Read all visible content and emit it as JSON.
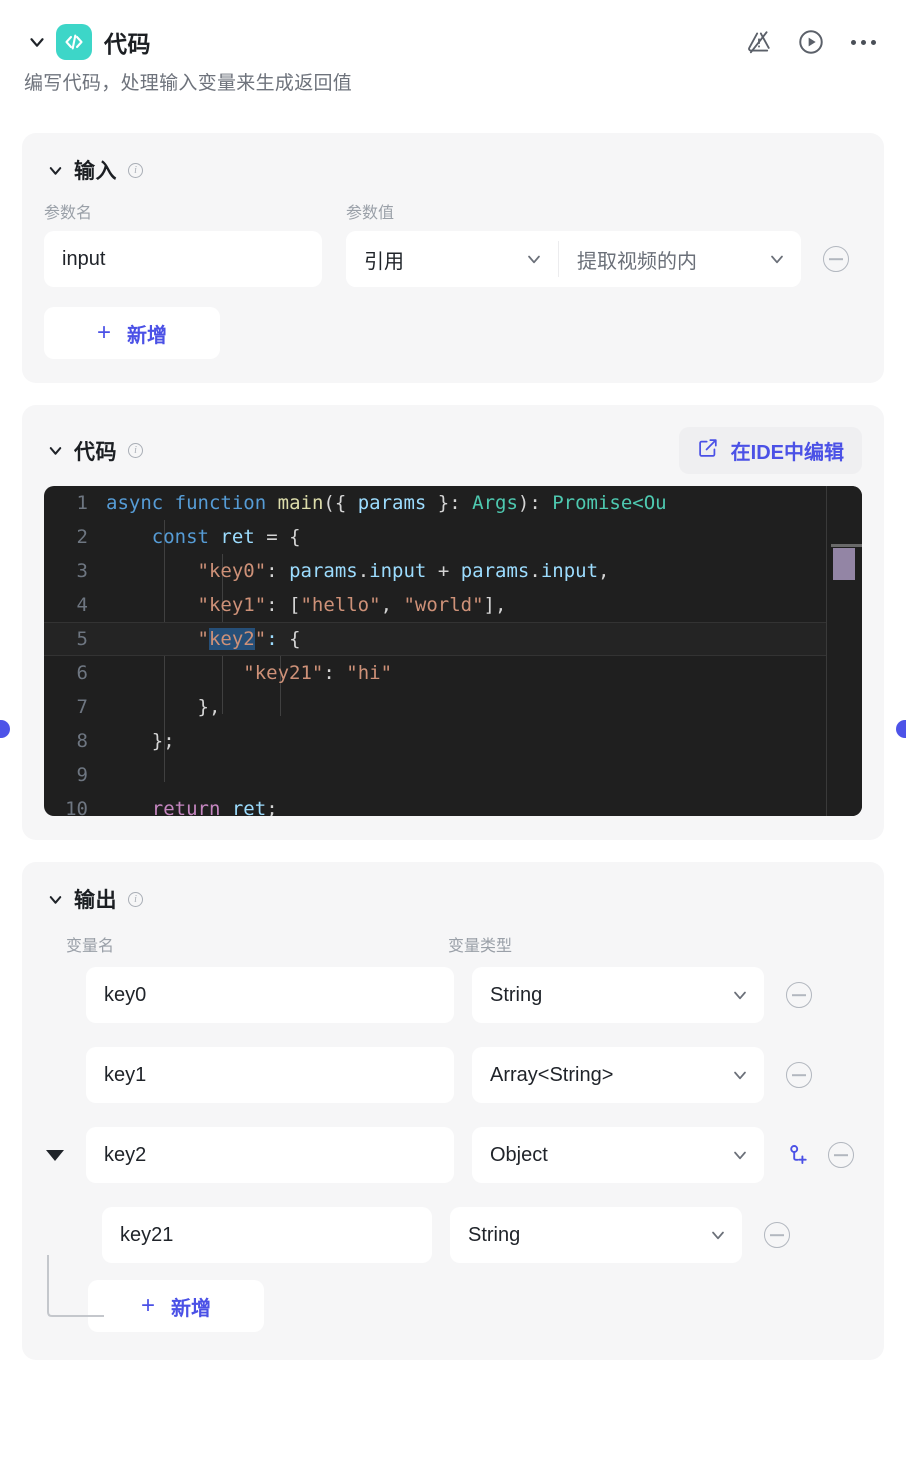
{
  "node": {
    "title": "代码",
    "subtitle": "编写代码，处理输入变量来生成返回值",
    "icon": "code-brackets-icon",
    "icon_color": "#3dd6c8",
    "collapse_icon": "chevron-down-icon",
    "actions": [
      {
        "name": "warning-off-icon",
        "label": ""
      },
      {
        "name": "run-icon",
        "label": ""
      },
      {
        "name": "more-icon",
        "label": ""
      }
    ]
  },
  "accent": "#4b51e6",
  "input_section": {
    "title": "输入",
    "info_icon": "info-icon",
    "columns": {
      "name": "参数名",
      "value": "参数值"
    },
    "rows": [
      {
        "param_name": "input",
        "value_kind": "引用",
        "value_source": "提取视频的内",
        "remove_icon": "minus-circle-icon"
      }
    ],
    "add_label": "新增",
    "add_icon": "plus-icon"
  },
  "code_section": {
    "title": "代码",
    "info_icon": "info-icon",
    "ide_button": {
      "label": "在IDE中编辑",
      "icon": "edit-square-icon"
    },
    "lines": [
      {
        "n": "1",
        "text": "async function main({ params }: Args): Promise<Ou"
      },
      {
        "n": "2",
        "text": "    const ret = {"
      },
      {
        "n": "3",
        "text": "        \"key0\": params.input + params.input,"
      },
      {
        "n": "4",
        "text": "        \"key1\": [\"hello\", \"world\"],"
      },
      {
        "n": "5",
        "text": "        \"key2\": {"
      },
      {
        "n": "6",
        "text": "            \"key21\": \"hi\""
      },
      {
        "n": "7",
        "text": "        },"
      },
      {
        "n": "8",
        "text": "    };"
      },
      {
        "n": "9",
        "text": ""
      },
      {
        "n": "10",
        "text": "    return ret;"
      }
    ],
    "selection": "key2",
    "active_line": "5"
  },
  "output_section": {
    "title": "输出",
    "info_icon": "info-icon",
    "columns": {
      "name": "变量名",
      "type": "变量类型"
    },
    "rows": [
      {
        "name": "key0",
        "type": "String",
        "child": false,
        "expandable": false,
        "can_add_child": false
      },
      {
        "name": "key1",
        "type": "Array<String>",
        "child": false,
        "expandable": false,
        "can_add_child": false
      },
      {
        "name": "key2",
        "type": "Object",
        "child": false,
        "expandable": true,
        "can_add_child": true
      },
      {
        "name": "key21",
        "type": "String",
        "child": true,
        "expandable": false,
        "can_add_child": false
      }
    ],
    "add_label": "新增",
    "add_icon": "plus-icon",
    "remove_icon": "minus-circle-icon",
    "add_child_icon": "add-sub-item-icon",
    "expand_icon": "triangle-down-icon",
    "caret_icon": "chevron-down-icon"
  }
}
